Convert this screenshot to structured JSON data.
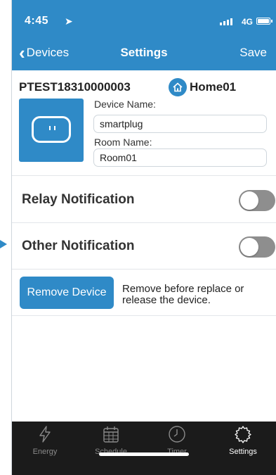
{
  "status_bar": {
    "time": "4:45",
    "location_icon": "location-arrow-icon",
    "network": "4G"
  },
  "nav": {
    "back_label": "Devices",
    "title": "Settings",
    "save_label": "Save"
  },
  "device": {
    "id": "PTEST18310000003",
    "home_name": "Home01",
    "device_name_label": "Device Name:",
    "device_name_value": "smartplug",
    "room_name_label": "Room Name:",
    "room_name_value": "Room01"
  },
  "notifications": {
    "relay_label": "Relay Notification",
    "relay_on": false,
    "other_label": "Other Notification",
    "other_on": false
  },
  "remove": {
    "button_label": "Remove Device",
    "description": "Remove before replace or release the device."
  },
  "tabs": [
    {
      "label": "Energy",
      "icon": "lightning-icon",
      "active": false
    },
    {
      "label": "Schedule",
      "icon": "calendar-icon",
      "active": false
    },
    {
      "label": "Timer",
      "icon": "clock-icon",
      "active": false
    },
    {
      "label": "Settings",
      "icon": "gear-icon",
      "active": true
    }
  ],
  "colors": {
    "accent": "#2f8ac7",
    "tabbar_bg": "#1b1b1b",
    "toggle_off": "#8e8e8e"
  }
}
